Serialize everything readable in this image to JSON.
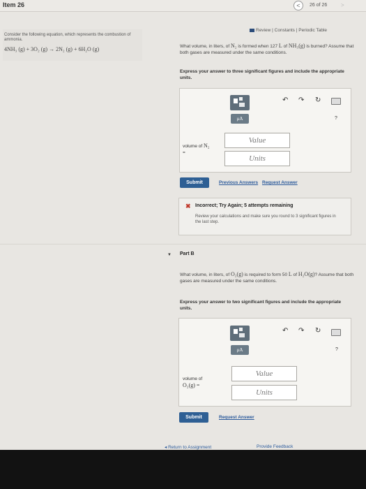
{
  "header": {
    "item_title": "Item 26",
    "pager_prev_glyph": "<",
    "pager_text": "26 of 26",
    "pager_next_glyph": ">"
  },
  "links": {
    "review": "Review",
    "sep": "|",
    "constants": "Constants",
    "periodic": "Periodic Table"
  },
  "left": {
    "intro": "Consider the following equation, which represents the combustion of ammonia.",
    "equation": "4NH₃ (g) + 3O₂ (g) → 2N₂ (g) + 6H₂O (g)"
  },
  "partA": {
    "q1": "What volume, in liters, of ",
    "q_species": "N₂",
    "q2": " is formed when 127 ",
    "q_unit": "L",
    "q3": " of ",
    "q_reactant": "NH₃(g)",
    "q4": " is burned? Assume that both gases are measured under the same conditions.",
    "instructions": "Express your answer to three significant figures and include the appropriate units.",
    "toolbar": {
      "mu": "μA",
      "help": "?"
    },
    "field_label_prefix": "volume of ",
    "field_label_species": "N₂",
    "field_label_eq": "=",
    "value_placeholder": "Value",
    "units_placeholder": "Units",
    "submit": "Submit",
    "previous_answers": "Previous Answers",
    "request_answer": "Request Answer",
    "feedback_mark": "✖",
    "feedback_title": "Incorrect; Try Again; 5 attempts remaining",
    "feedback_body": "Review your calculations and make sure you round to 3 significant figures in the last step."
  },
  "partB": {
    "caret": "▼",
    "title": "Part B",
    "q1": "What volume, in liters, of ",
    "q_species": "O₂(g)",
    "q2": " is required to form 50 ",
    "q_unit": "L",
    "q3": " of ",
    "q_product": "H₂O(g)",
    "q4": "? Assume that both gases are measured under the same conditions.",
    "instructions": "Express your answer to two significant figures and include the appropriate units.",
    "toolbar": {
      "mu": "μA",
      "help": "?"
    },
    "field_label_line1": "volume of",
    "field_label_line2": "O₂(g) =",
    "value_placeholder": "Value",
    "units_placeholder": "Units",
    "submit": "Submit",
    "request_answer": "Request Answer"
  },
  "footer": {
    "return": "◂ Return to Assignment",
    "feedback": "Provide Feedback"
  }
}
